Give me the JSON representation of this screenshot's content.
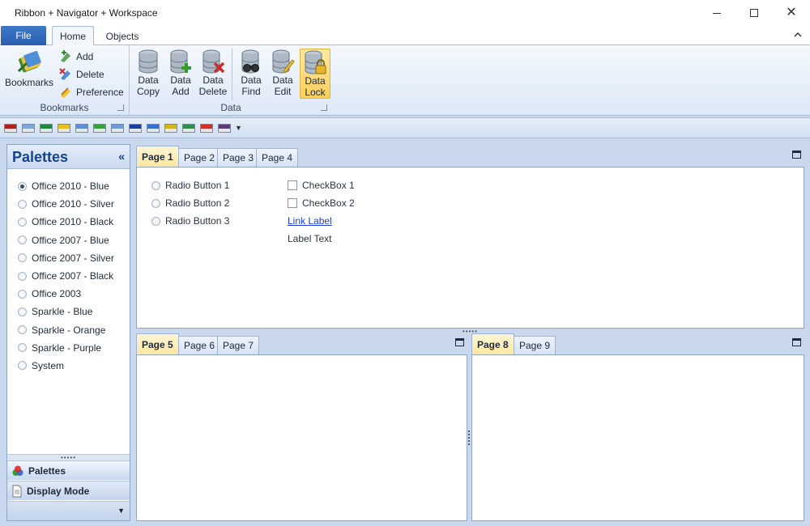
{
  "window": {
    "title": "Ribbon + Navigator + Workspace"
  },
  "ribbon": {
    "file_tab": "File",
    "tabs": [
      {
        "label": "Home"
      },
      {
        "label": "Objects"
      }
    ],
    "groups": {
      "bookmarks": {
        "title": "Bookmarks",
        "big_button": "Bookmarks",
        "small_buttons": [
          {
            "label": "Add"
          },
          {
            "label": "Delete"
          },
          {
            "label": "Preference"
          }
        ]
      },
      "data": {
        "title": "Data",
        "buttons": [
          {
            "line1": "Data",
            "line2": "Copy"
          },
          {
            "line1": "Data",
            "line2": "Add"
          },
          {
            "line1": "Data",
            "line2": "Delete"
          },
          {
            "line1": "Data",
            "line2": "Find"
          },
          {
            "line1": "Data",
            "line2": "Edit"
          },
          {
            "line1": "Data",
            "line2": "Lock"
          }
        ]
      }
    }
  },
  "navigator": {
    "title": "Palettes",
    "palettes": [
      {
        "label": "Office 2010 - Blue",
        "checked": true
      },
      {
        "label": "Office 2010 - Silver",
        "checked": false
      },
      {
        "label": "Office 2010 - Black",
        "checked": false
      },
      {
        "label": "Office 2007 - Blue",
        "checked": false
      },
      {
        "label": "Office 2007 - Silver",
        "checked": false
      },
      {
        "label": "Office 2007 - Black",
        "checked": false
      },
      {
        "label": "Office 2003",
        "checked": false
      },
      {
        "label": "Sparkle - Blue",
        "checked": false
      },
      {
        "label": "Sparkle - Orange",
        "checked": false
      },
      {
        "label": "Sparkle - Purple",
        "checked": false
      },
      {
        "label": "System",
        "checked": false
      }
    ],
    "buttons": {
      "palettes": "Palettes",
      "display_mode": "Display Mode"
    }
  },
  "workspace": {
    "top": {
      "tabs": [
        {
          "label": "Page 1"
        },
        {
          "label": "Page 2"
        },
        {
          "label": "Page 3"
        },
        {
          "label": "Page 4"
        }
      ],
      "radios": [
        {
          "label": "Radio Button 1"
        },
        {
          "label": "Radio Button 2"
        },
        {
          "label": "Radio Button 3"
        }
      ],
      "checkboxes": [
        {
          "label": "CheckBox 1"
        },
        {
          "label": "CheckBox 2"
        }
      ],
      "link_label": "Link Label",
      "label_text": "Label Text"
    },
    "bottom_left": {
      "tabs": [
        {
          "label": "Page 5"
        },
        {
          "label": "Page 6"
        },
        {
          "label": "Page 7"
        }
      ]
    },
    "bottom_right": {
      "tabs": [
        {
          "label": "Page 8"
        },
        {
          "label": "Page 9"
        }
      ]
    }
  },
  "toolstrip": {
    "flags": [
      "#b0201a",
      "#7aa7d8",
      "#1f8a3c",
      "#e6c01f",
      "#5f8fd6",
      "#3a9f3a",
      "#6f9bd8",
      "#1b3f9c",
      "#3b6fcf",
      "#d2b41c",
      "#2f8d4a",
      "#d0302a",
      "#5a3a7a"
    ]
  },
  "colors": {
    "accent": "#2a5fb0",
    "active_tab": "#fde7a0",
    "link": "#1a3ee0"
  }
}
